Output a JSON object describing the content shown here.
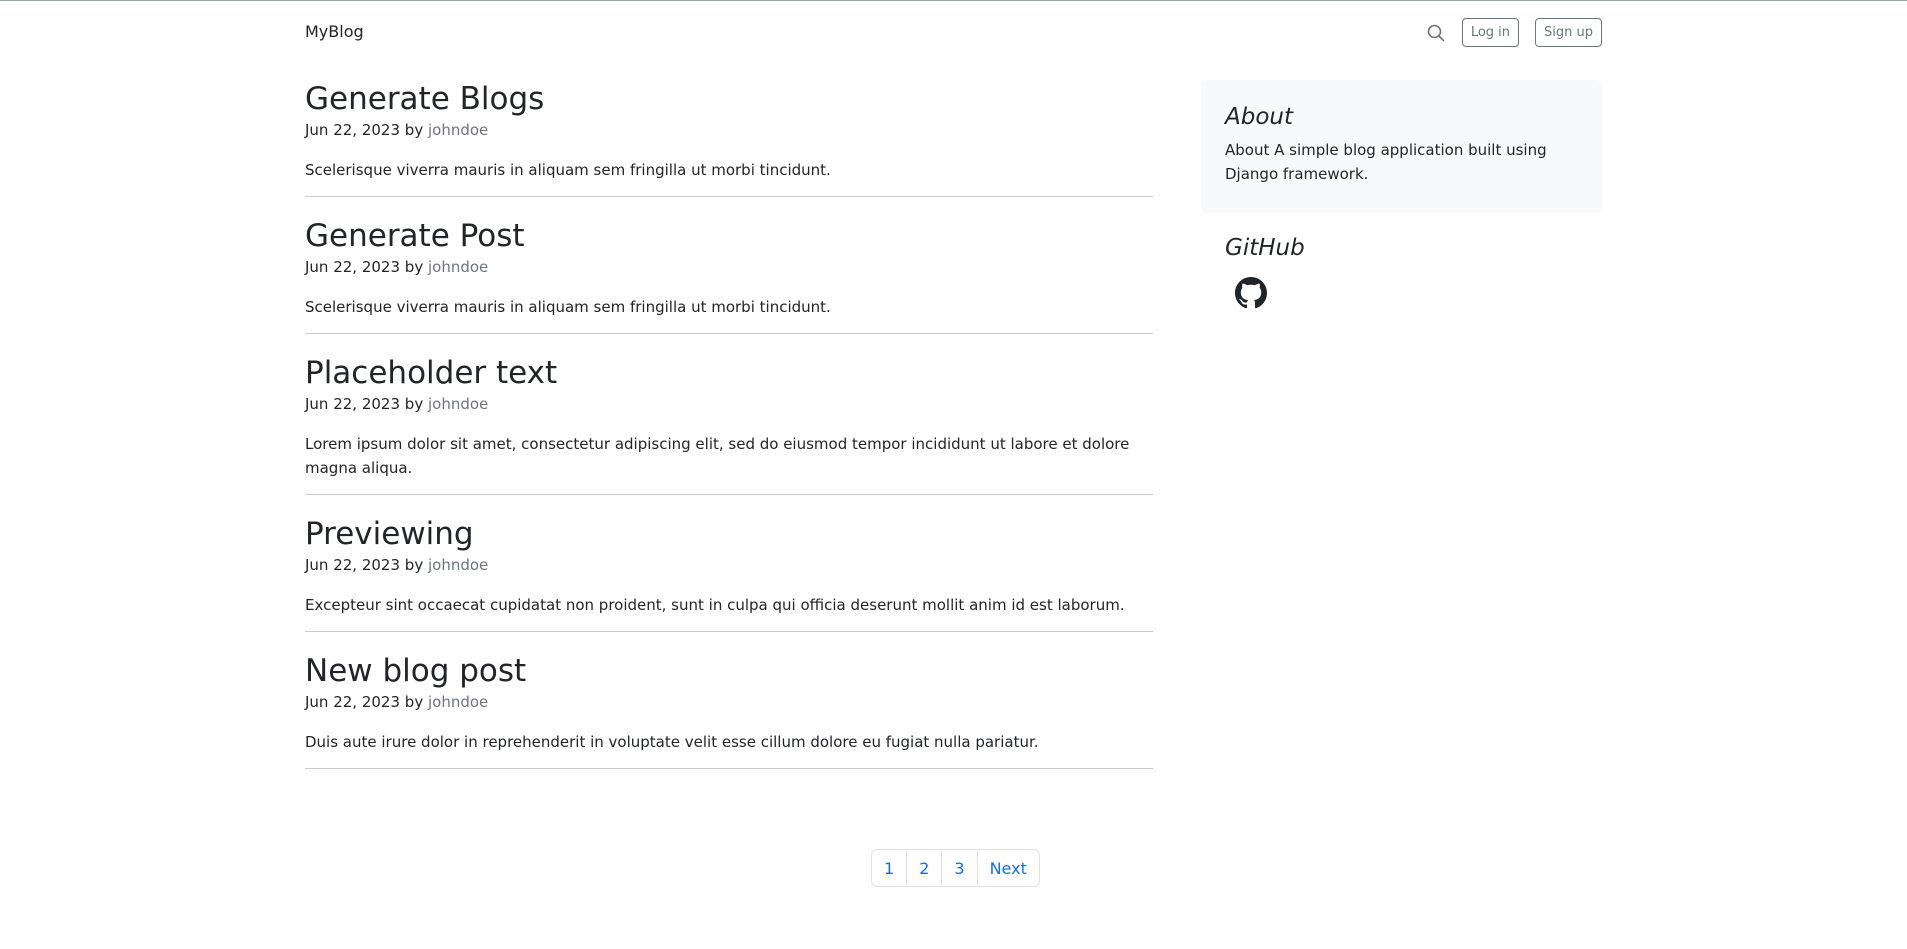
{
  "header": {
    "brand": "MyBlog",
    "search_icon": "search-icon",
    "login_label": "Log in",
    "signup_label": "Sign up"
  },
  "posts": [
    {
      "title": "Generate Blogs",
      "date": "Jun 22, 2023",
      "by": "by",
      "author": "johndoe",
      "excerpt": "Scelerisque viverra mauris in aliquam sem fringilla ut morbi tincidunt."
    },
    {
      "title": "Generate Post",
      "date": "Jun 22, 2023",
      "by": "by",
      "author": "johndoe",
      "excerpt": "Scelerisque viverra mauris in aliquam sem fringilla ut morbi tincidunt."
    },
    {
      "title": "Placeholder text",
      "date": "Jun 22, 2023",
      "by": "by",
      "author": "johndoe",
      "excerpt": "Lorem ipsum dolor sit amet, consectetur adipiscing elit, sed do eiusmod tempor incididunt ut labore et dolore magna aliqua."
    },
    {
      "title": "Previewing",
      "date": "Jun 22, 2023",
      "by": "by",
      "author": "johndoe",
      "excerpt": "Excepteur sint occaecat cupidatat non proident, sunt in culpa qui officia deserunt mollit anim id est laborum."
    },
    {
      "title": "New blog post",
      "date": "Jun 22, 2023",
      "by": "by",
      "author": "johndoe",
      "excerpt": "Duis aute irure dolor in reprehenderit in voluptate velit esse cillum dolore eu fugiat nulla pariatur."
    }
  ],
  "pagination": {
    "pages": [
      "1",
      "2",
      "3"
    ],
    "next_label": "Next"
  },
  "sidebar": {
    "about_title": "About",
    "about_text": "About A simple blog application built using Django framework.",
    "github_title": "GitHub",
    "github_icon": "github-icon"
  },
  "colors": {
    "link": "#0d6efd",
    "muted": "#6c757d",
    "sidebar_bg": "#f8f9fa"
  }
}
